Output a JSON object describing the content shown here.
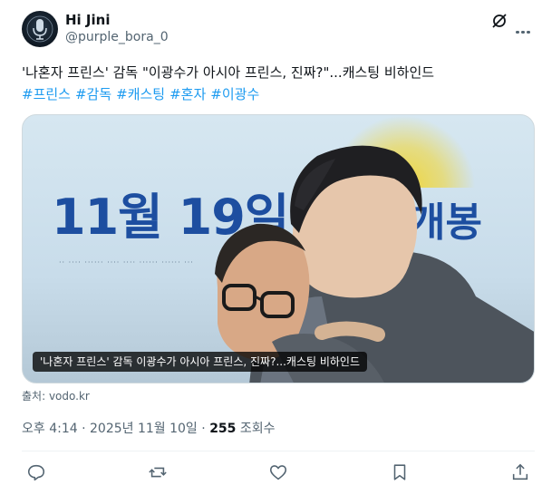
{
  "author": {
    "name": "Hi Jini",
    "handle": "@purple_bora_0"
  },
  "tweet": {
    "text": "'나혼자 프린스' 감독 \"이광수가 아시아 프린스, 진짜?\"...캐스팅 비하인드",
    "hashtags": [
      "#프린스",
      "#감독",
      "#캐스팅",
      "#혼자",
      "#이광수"
    ]
  },
  "media": {
    "banner_text": "11월 19일",
    "banner_text_right": "개봉",
    "caption": "'나혼자 프린스' 감독 이광수가 아시아 프린스, 진짜?...캐스팅 비하인드",
    "source": "출처: vodo.kr"
  },
  "meta": {
    "time": "오후 4:14",
    "date": "2025년 11월 10일",
    "separator": "·",
    "views": "255",
    "views_label": "조회수"
  },
  "icons": {
    "grok": "grok-icon",
    "more": "more-icon",
    "reply": "reply-icon",
    "retweet": "retweet-icon",
    "like": "like-icon",
    "bookmark": "bookmark-icon",
    "share": "share-icon"
  },
  "colors": {
    "text": "#0f1419",
    "secondary": "#536471",
    "link": "#1d9bf0",
    "border": "#cfd9de"
  }
}
